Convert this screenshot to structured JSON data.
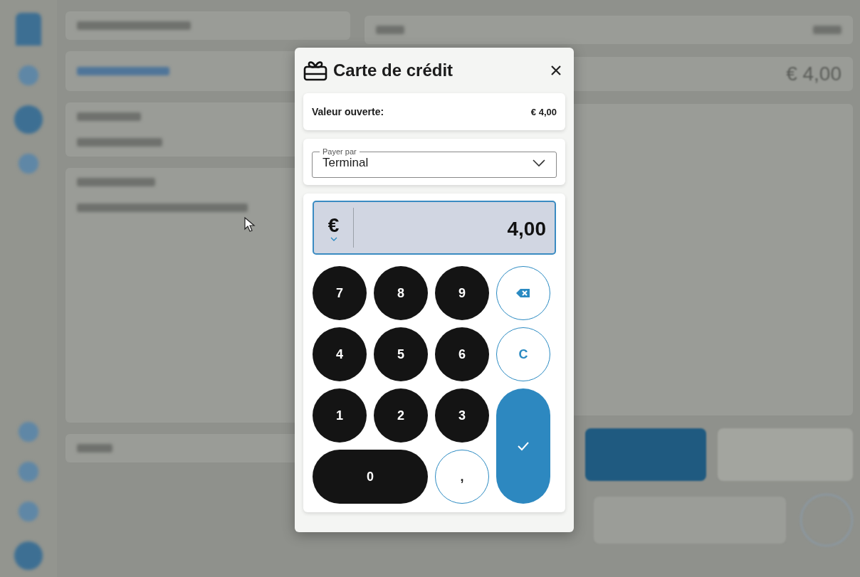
{
  "dialog": {
    "title": "Carte de crédit",
    "open_value": {
      "label": "Valeur ouverte:",
      "value": "€ 4,00"
    },
    "pay_by": {
      "label": "Payer par",
      "value": "Terminal"
    },
    "amount": {
      "currency": "€",
      "value": "4,00"
    },
    "keypad": [
      {
        "kind": "digit",
        "label": "7"
      },
      {
        "kind": "digit",
        "label": "8"
      },
      {
        "kind": "digit",
        "label": "9"
      },
      {
        "kind": "backspace"
      },
      {
        "kind": "digit",
        "label": "4"
      },
      {
        "kind": "digit",
        "label": "5"
      },
      {
        "kind": "digit",
        "label": "6"
      },
      {
        "kind": "clear",
        "label": "C"
      },
      {
        "kind": "digit",
        "label": "1"
      },
      {
        "kind": "digit",
        "label": "2"
      },
      {
        "kind": "digit",
        "label": "3"
      },
      {
        "kind": "confirm"
      },
      {
        "kind": "digit",
        "label": "0"
      },
      {
        "kind": "decimal",
        "label": ","
      }
    ]
  },
  "background": {
    "total_amount": "€ 4,00"
  }
}
